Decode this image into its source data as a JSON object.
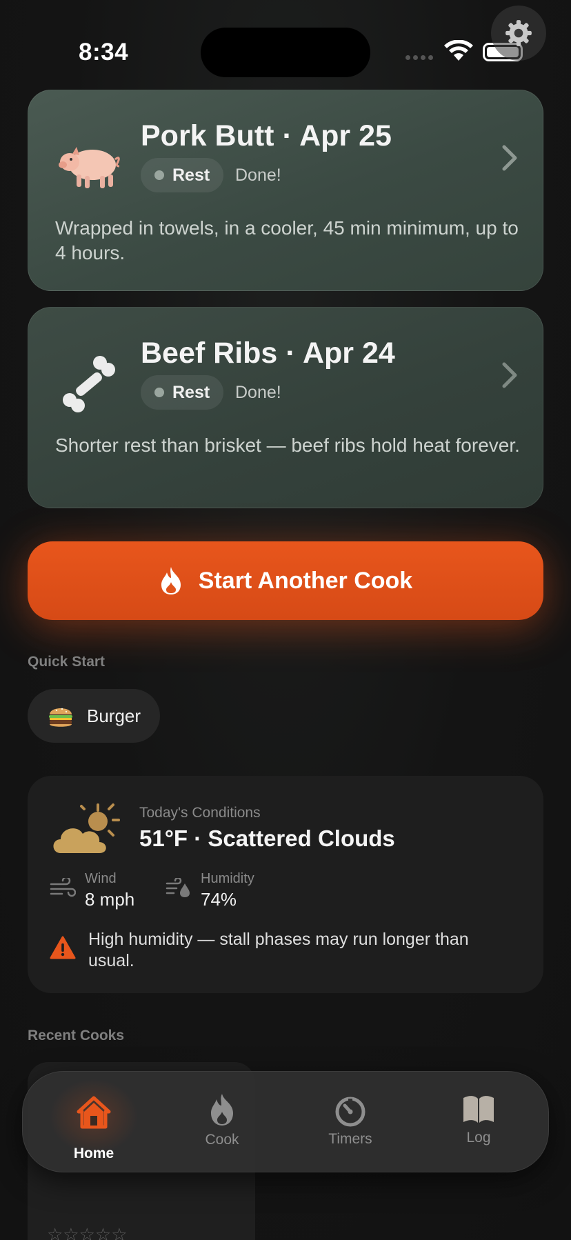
{
  "status_bar": {
    "time": "8:34"
  },
  "cooks": [
    {
      "title": "Pork Butt · Apr 25",
      "emoji": "🐖",
      "icon": "pig-icon",
      "phase": "Rest",
      "status": "Done!",
      "description": "Wrapped in towels, in a cooler, 45 min minimum, up to 4 hours."
    },
    {
      "title": "Beef Ribs · Apr 24",
      "emoji": "🦴",
      "icon": "bone-icon",
      "phase": "Rest",
      "status": "Done!",
      "description": "Shorter rest than brisket — beef ribs hold heat forever."
    }
  ],
  "start_button": {
    "label": "Start Another Cook",
    "icon": "flame-icon"
  },
  "quick_start": {
    "title": "Quick Start",
    "items": [
      {
        "label": "Burger",
        "emoji": "🍔",
        "icon": "burger-icon"
      }
    ]
  },
  "weather": {
    "label": "Today's Conditions",
    "summary": "51°F · Scattered Clouds",
    "icon": "partly-cloudy-icon",
    "wind": {
      "label": "Wind",
      "value": "8 mph"
    },
    "humidity": {
      "label": "Humidity",
      "value": "74%"
    },
    "warning": "High humidity — stall phases may run longer than usual."
  },
  "recent": {
    "title": "Recent Cooks",
    "stars": "☆☆☆☆☆"
  },
  "tabs": [
    {
      "label": "Home",
      "icon": "house-icon",
      "active": true
    },
    {
      "label": "Cook",
      "icon": "flame-icon",
      "active": false
    },
    {
      "label": "Timers",
      "icon": "timer-icon",
      "active": false
    },
    {
      "label": "Log",
      "icon": "book-icon",
      "active": false
    }
  ],
  "colors": {
    "accent": "#E8561C",
    "card": "#3E4C45",
    "tab_inactive": "#8E8E8E",
    "weather_icon": "#C9A25C"
  }
}
